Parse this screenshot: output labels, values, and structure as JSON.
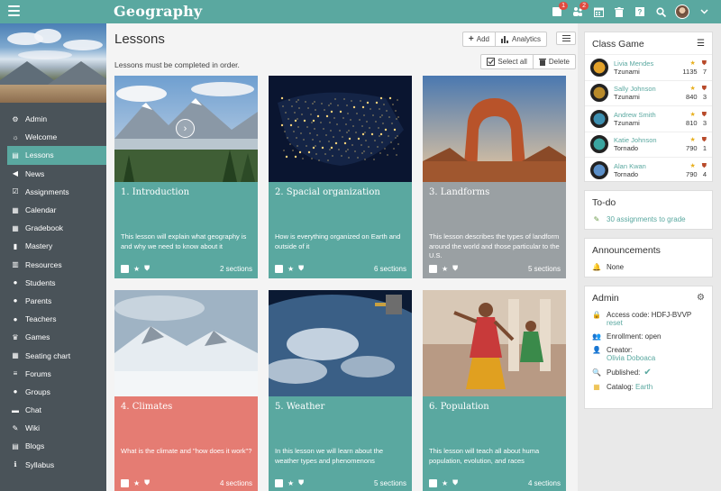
{
  "app_title": "Geography",
  "colors": {
    "accent": "#5aa8a0",
    "sidebar": "#4a5359",
    "coral": "#e57c73",
    "gray_card": "#9aa0a3"
  },
  "topbar": {
    "badges": {
      "notifications": "1",
      "requests": "2"
    },
    "icons": [
      "envelope-icon",
      "user-requests-icon",
      "calendar-icon",
      "trash-icon",
      "help-icon",
      "search-icon",
      "avatar",
      "chevron-down-icon"
    ],
    "help_label": "?"
  },
  "sidebar": {
    "items": [
      {
        "label": "Admin",
        "icon": "gear-icon"
      },
      {
        "label": "Welcome",
        "icon": "sun-icon"
      },
      {
        "label": "Lessons",
        "icon": "book-icon",
        "active": true
      },
      {
        "label": "News",
        "icon": "megaphone-icon"
      },
      {
        "label": "Assignments",
        "icon": "check-square-icon"
      },
      {
        "label": "Calendar",
        "icon": "calendar-icon"
      },
      {
        "label": "Gradebook",
        "icon": "grid-icon"
      },
      {
        "label": "Mastery",
        "icon": "bar-chart-icon"
      },
      {
        "label": "Resources",
        "icon": "library-icon"
      },
      {
        "label": "Students",
        "icon": "user-icon"
      },
      {
        "label": "Parents",
        "icon": "parent-icon"
      },
      {
        "label": "Teachers",
        "icon": "teacher-icon"
      },
      {
        "label": "Games",
        "icon": "trophy-icon"
      },
      {
        "label": "Seating chart",
        "icon": "seats-icon"
      },
      {
        "label": "Forums",
        "icon": "list-icon"
      },
      {
        "label": "Groups",
        "icon": "groups-icon"
      },
      {
        "label": "Chat",
        "icon": "chat-icon"
      },
      {
        "label": "Wiki",
        "icon": "edit-icon"
      },
      {
        "label": "Blogs",
        "icon": "blog-icon"
      },
      {
        "label": "Syllabus",
        "icon": "info-icon"
      }
    ]
  },
  "main": {
    "title": "Lessons",
    "add_label": "Add",
    "analytics_label": "Analytics",
    "notice": "Lessons must be completed in order.",
    "select_all_label": "Select all",
    "delete_label": "Delete",
    "lessons": [
      {
        "title": "1. Introduction",
        "desc": "This lesson will explain what geography is and why we need to know about it",
        "sections": "2 sections",
        "color": "#5aa8a0",
        "image": "mountains"
      },
      {
        "title": "2. Spacial organization",
        "desc": "How is everything organized on Earth and outside of it",
        "sections": "6 sections",
        "color": "#5aa8a0",
        "image": "night-map"
      },
      {
        "title": "3. Landforms",
        "desc": "This lesson describes the types of landform around the world and those particular to the U.S.",
        "sections": "5 sections",
        "color": "#9aa0a3",
        "image": "arch"
      },
      {
        "title": "4. Climates",
        "desc": "What is the climate and \"how does it work\"?",
        "sections": "4 sections",
        "color": "#e57c73",
        "image": "snow"
      },
      {
        "title": "5. Weather",
        "desc": "In this lesson we will learn about the weather types and phenomenons",
        "sections": "5 sections",
        "color": "#5aa8a0",
        "image": "earth"
      },
      {
        "title": "6. Population",
        "desc": "This lesson will teach all about huma population, evolution, and races",
        "sections": "4 sections",
        "color": "#5aa8a0",
        "image": "dancers"
      }
    ]
  },
  "class_game": {
    "title": "Class Game",
    "players": [
      {
        "name": "Livia Mendes",
        "team": "Tzunami",
        "points": "1135",
        "badges": "7",
        "rank": "1",
        "ring": "#e2a12a"
      },
      {
        "name": "Sally Johnson",
        "team": "Tzunami",
        "points": "840",
        "badges": "3",
        "rank": "2",
        "ring": "#b88a2a"
      },
      {
        "name": "Andrew Smith",
        "team": "Tzunami",
        "points": "810",
        "badges": "3",
        "rank": "3",
        "ring": "#3d8fb0"
      },
      {
        "name": "Katie Johnson",
        "team": "Tornado",
        "points": "790",
        "badges": "1",
        "rank": "4",
        "ring": "#3aa5a0"
      },
      {
        "name": "Alan Kwan",
        "team": "Tornado",
        "points": "790",
        "badges": "4",
        "rank": "5",
        "ring": "#5b8fc8"
      }
    ]
  },
  "todo": {
    "title": "To-do",
    "item": "30 assignments to grade"
  },
  "announcements": {
    "title": "Announcements",
    "item": "None"
  },
  "admin": {
    "title": "Admin",
    "access_code_label": "Access code: HDFJ-BVVP",
    "reset_label": "reset",
    "enrollment_label": "Enrollment: open",
    "creator_label": "Creator:",
    "creator_name": "Olivia Doboaca",
    "published_label": "Published:",
    "catalog_label": "Catalog:",
    "catalog_value": "Earth"
  }
}
